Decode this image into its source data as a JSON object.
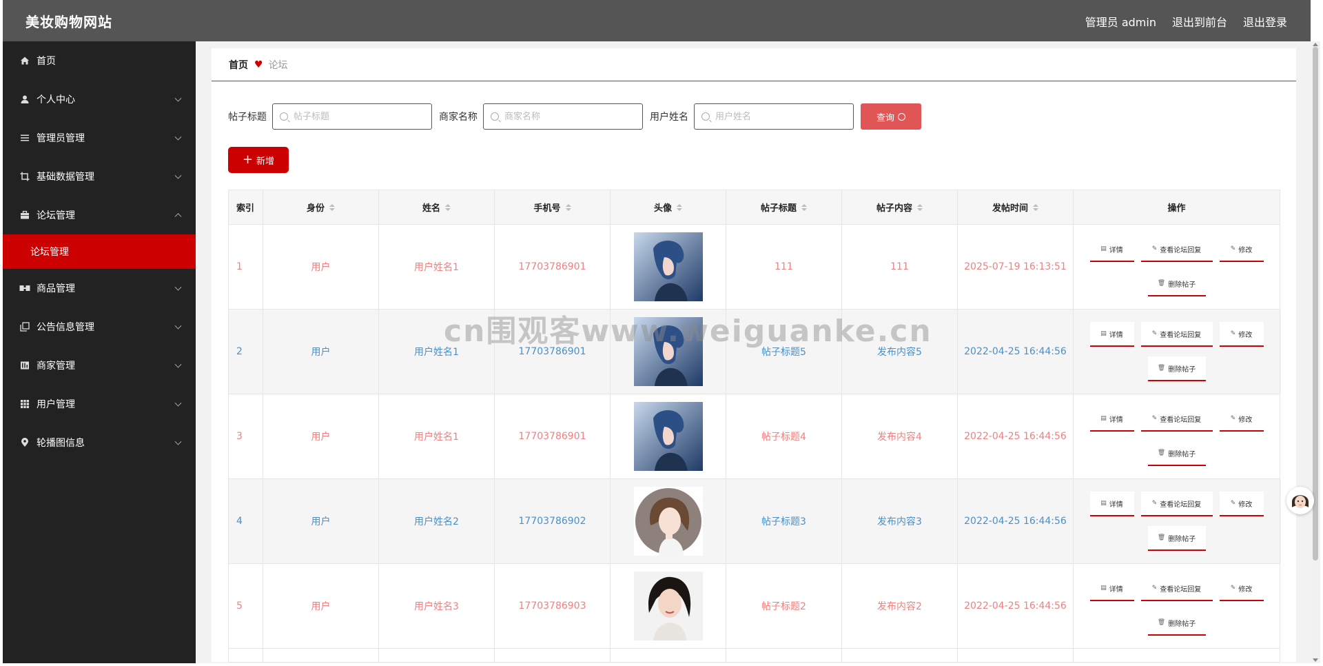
{
  "header": {
    "brand": "美妆购物网站",
    "admin_label": "管理员 admin",
    "to_front_label": "退出到前台",
    "logout_label": "退出登录"
  },
  "sidebar": {
    "items": [
      {
        "label": "首页",
        "icon": "home-icon",
        "expandable": false
      },
      {
        "label": "个人中心",
        "icon": "user-icon",
        "expandable": true
      },
      {
        "label": "管理员管理",
        "icon": "list-icon",
        "expandable": true
      },
      {
        "label": "基础数据管理",
        "icon": "crop-icon",
        "expandable": true
      },
      {
        "label": "论坛管理",
        "icon": "briefcase-icon",
        "expandable": true,
        "expanded": true
      },
      {
        "label": "商品管理",
        "icon": "goods-icon",
        "expandable": true
      },
      {
        "label": "公告信息管理",
        "icon": "copy-icon",
        "expandable": true
      },
      {
        "label": "商家管理",
        "icon": "merchant-icon",
        "expandable": true
      },
      {
        "label": "用户管理",
        "icon": "grid-icon",
        "expandable": true
      },
      {
        "label": "轮播图信息",
        "icon": "location-icon",
        "expandable": true
      }
    ],
    "submenu_active": "论坛管理"
  },
  "breadcrumb": {
    "home": "首页",
    "current": "论坛"
  },
  "search": {
    "title_label": "帖子标题",
    "title_placeholder": "帖子标题",
    "merchant_label": "商家名称",
    "merchant_placeholder": "商家名称",
    "user_label": "用户姓名",
    "user_placeholder": "用户姓名",
    "query_label": "查询"
  },
  "add_label": "新增",
  "table": {
    "headers": [
      "索引",
      "身份",
      "姓名",
      "手机号",
      "头像",
      "帖子标题",
      "帖子内容",
      "发帖时间",
      "操作"
    ],
    "sortable": [
      false,
      true,
      true,
      true,
      true,
      true,
      true,
      true,
      false
    ],
    "rows": [
      {
        "index": "1",
        "role": "用户",
        "name": "用户姓名1",
        "phone": "17703786901",
        "avatar": "boy",
        "title": "111",
        "content": "111",
        "time": "2025-07-19 16:13:51"
      },
      {
        "index": "2",
        "role": "用户",
        "name": "用户姓名1",
        "phone": "17703786901",
        "avatar": "boy",
        "title": "帖子标题5",
        "content": "发布内容5",
        "time": "2022-04-25 16:44:56"
      },
      {
        "index": "3",
        "role": "用户",
        "name": "用户姓名1",
        "phone": "17703786901",
        "avatar": "boy",
        "title": "帖子标题4",
        "content": "发布内容4",
        "time": "2022-04-25 16:44:56"
      },
      {
        "index": "4",
        "role": "用户",
        "name": "用户姓名2",
        "phone": "17703786902",
        "avatar": "girl",
        "title": "帖子标题3",
        "content": "发布内容3",
        "time": "2022-04-25 16:44:56"
      },
      {
        "index": "5",
        "role": "用户",
        "name": "用户姓名3",
        "phone": "17703786903",
        "avatar": "woman",
        "title": "帖子标题2",
        "content": "发布内容2",
        "time": "2022-04-25 16:44:56"
      }
    ],
    "actions": {
      "detail": "详情",
      "view_replies": "查看论坛回复",
      "edit": "修改",
      "delete": "删除帖子"
    }
  },
  "watermark": "cn围观客www.weiguanke.cn",
  "colors": {
    "header_bg": "#555555",
    "sidebar_bg": "#222222",
    "accent_red": "#cc0000",
    "query_btn": "#e05555",
    "odd_row_text": "#f08080",
    "even_row_text": "#4a90c8"
  }
}
